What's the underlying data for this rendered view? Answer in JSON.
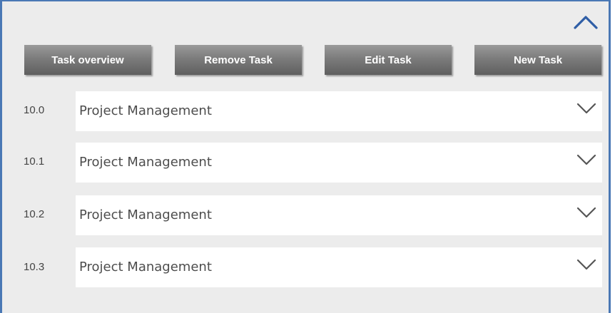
{
  "toolbar": {
    "task_overview": "Task overview",
    "remove_task": "Remove Task",
    "edit_task": "Edit Task",
    "new_task": "New Task"
  },
  "tasks": [
    {
      "number": "10.0",
      "name": "Project Management"
    },
    {
      "number": "10.1",
      "name": "Project Management"
    },
    {
      "number": "10.2",
      "name": "Project Management"
    },
    {
      "number": "10.3",
      "name": "Project Management"
    }
  ],
  "icons": {
    "collapse": "chevron-up-icon",
    "expand": "chevron-down-icon"
  },
  "colors": {
    "accent": "#2f5ea6",
    "panel_background": "#ececec",
    "button_gradient_top": "#9a9a9a",
    "button_gradient_bottom": "#5f5f5f"
  }
}
